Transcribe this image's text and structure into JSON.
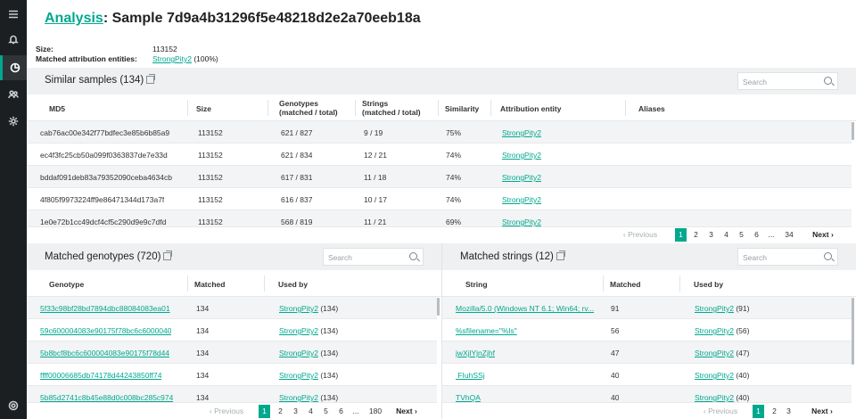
{
  "sidebar": {
    "icons": [
      "menu-icon",
      "bell-icon",
      "analysis-icon",
      "users-icon",
      "gear-icon",
      "help-icon"
    ]
  },
  "header": {
    "title_link": "Analysis",
    "title_rest": ": Sample 7d9a4b31296f5e48218d2e2a70eeb18a"
  },
  "meta": {
    "size_label": "Size:",
    "size_value": "113152",
    "entities_label": "Matched attribution entities:",
    "entity_link": "StrongPity2",
    "entity_pct": " (100%)"
  },
  "similar": {
    "title": "Similar samples (134)",
    "search_placeholder": "Search",
    "columns": {
      "md5": "MD5",
      "size": "Size",
      "genotypes_1": "Genotypes",
      "genotypes_2": "(matched / total)",
      "strings_1": "Strings",
      "strings_2": "(matched / total)",
      "similarity": "Similarity",
      "entity": "Attribution entity",
      "aliases": "Aliases"
    },
    "rows": [
      {
        "md5": "cab76ac00e342f77bdfec3e85b6b85a9",
        "size": "113152",
        "genotypes": "621 / 827",
        "strings": "9 / 19",
        "similarity": "75%",
        "entity": "StrongPity2"
      },
      {
        "md5": "ec4f3fc25cb50a099f0363837de7e33d",
        "size": "113152",
        "genotypes": "621 / 834",
        "strings": "12 / 21",
        "similarity": "74%",
        "entity": "StrongPity2"
      },
      {
        "md5": "bddaf091deb83a79352090ceba4634cb",
        "size": "113152",
        "genotypes": "617 / 831",
        "strings": "11 / 18",
        "similarity": "74%",
        "entity": "StrongPity2"
      },
      {
        "md5": "4f805f9973224ff9e86471344d173a7f",
        "size": "113152",
        "genotypes": "616 / 837",
        "strings": "10 / 17",
        "similarity": "74%",
        "entity": "StrongPity2"
      },
      {
        "md5": "1e0e72b1cc49dcf4cf5c290d9e9c7dfd",
        "size": "113152",
        "genotypes": "568 / 819",
        "strings": "11 / 21",
        "similarity": "69%",
        "entity": "StrongPity2"
      }
    ],
    "pager": {
      "prev": "Previous",
      "pages": [
        "1",
        "2",
        "3",
        "4",
        "5",
        "6",
        "...",
        "34"
      ],
      "next": "Next"
    }
  },
  "genotypes": {
    "title": "Matched genotypes (720)",
    "search_placeholder": "Search",
    "columns": {
      "genotype": "Genotype",
      "matched": "Matched",
      "used_by": "Used by"
    },
    "rows": [
      {
        "genotype": "5f33c98bf28bd7894dbc88084083ea01",
        "matched": "134",
        "used_by": "StrongPity2",
        "count": " (134)"
      },
      {
        "genotype": "59c600004083e90175f78bc6c6000040",
        "matched": "134",
        "used_by": "StrongPity2",
        "count": " (134)"
      },
      {
        "genotype": "5b8bcf8bc6c600004083e90175f78d44",
        "matched": "134",
        "used_by": "StrongPity2",
        "count": " (134)"
      },
      {
        "genotype": "ffff00006685db74178d44243850ff74",
        "matched": "134",
        "used_by": "StrongPity2",
        "count": " (134)"
      },
      {
        "genotype": "5b85d2741c8b45e88d0c008bc285c974",
        "matched": "134",
        "used_by": "StrongPity2",
        "count": " (134)"
      }
    ],
    "pager": {
      "prev": "Previous",
      "pages": [
        "1",
        "2",
        "3",
        "4",
        "5",
        "6",
        "...",
        "180"
      ],
      "next": "Next"
    }
  },
  "strings": {
    "title": "Matched strings (12)",
    "search_placeholder": "Search",
    "columns": {
      "string": "String",
      "matched": "Matched",
      "used_by": "Used by"
    },
    "rows": [
      {
        "string": "Mozilla/5.0 (Windows NT 6.1; Win64; rv...",
        "matched": "91",
        "used_by": "StrongPity2",
        "count": " (91)"
      },
      {
        "string": "%sfilename=\"%ls\"",
        "matched": "56",
        "used_by": "StrongPity2",
        "count": " (56)"
      },
      {
        "string": "jwXjlYjnZjhf",
        "matched": "47",
        "used_by": "StrongPity2",
        "count": " (47)"
      },
      {
        "string": " FIuhSSj",
        "matched": "40",
        "used_by": "StrongPity2",
        "count": " (40)"
      },
      {
        "string": "TVhQA",
        "matched": "40",
        "used_by": "StrongPity2",
        "count": " (40)"
      }
    ],
    "pager": {
      "prev": "Previous",
      "pages": [
        "1",
        "2",
        "3"
      ],
      "next": "Next"
    }
  },
  "colors": {
    "accent": "#00a88e",
    "sidebar": "#1c1f21",
    "section_bg": "#eef0f1"
  }
}
